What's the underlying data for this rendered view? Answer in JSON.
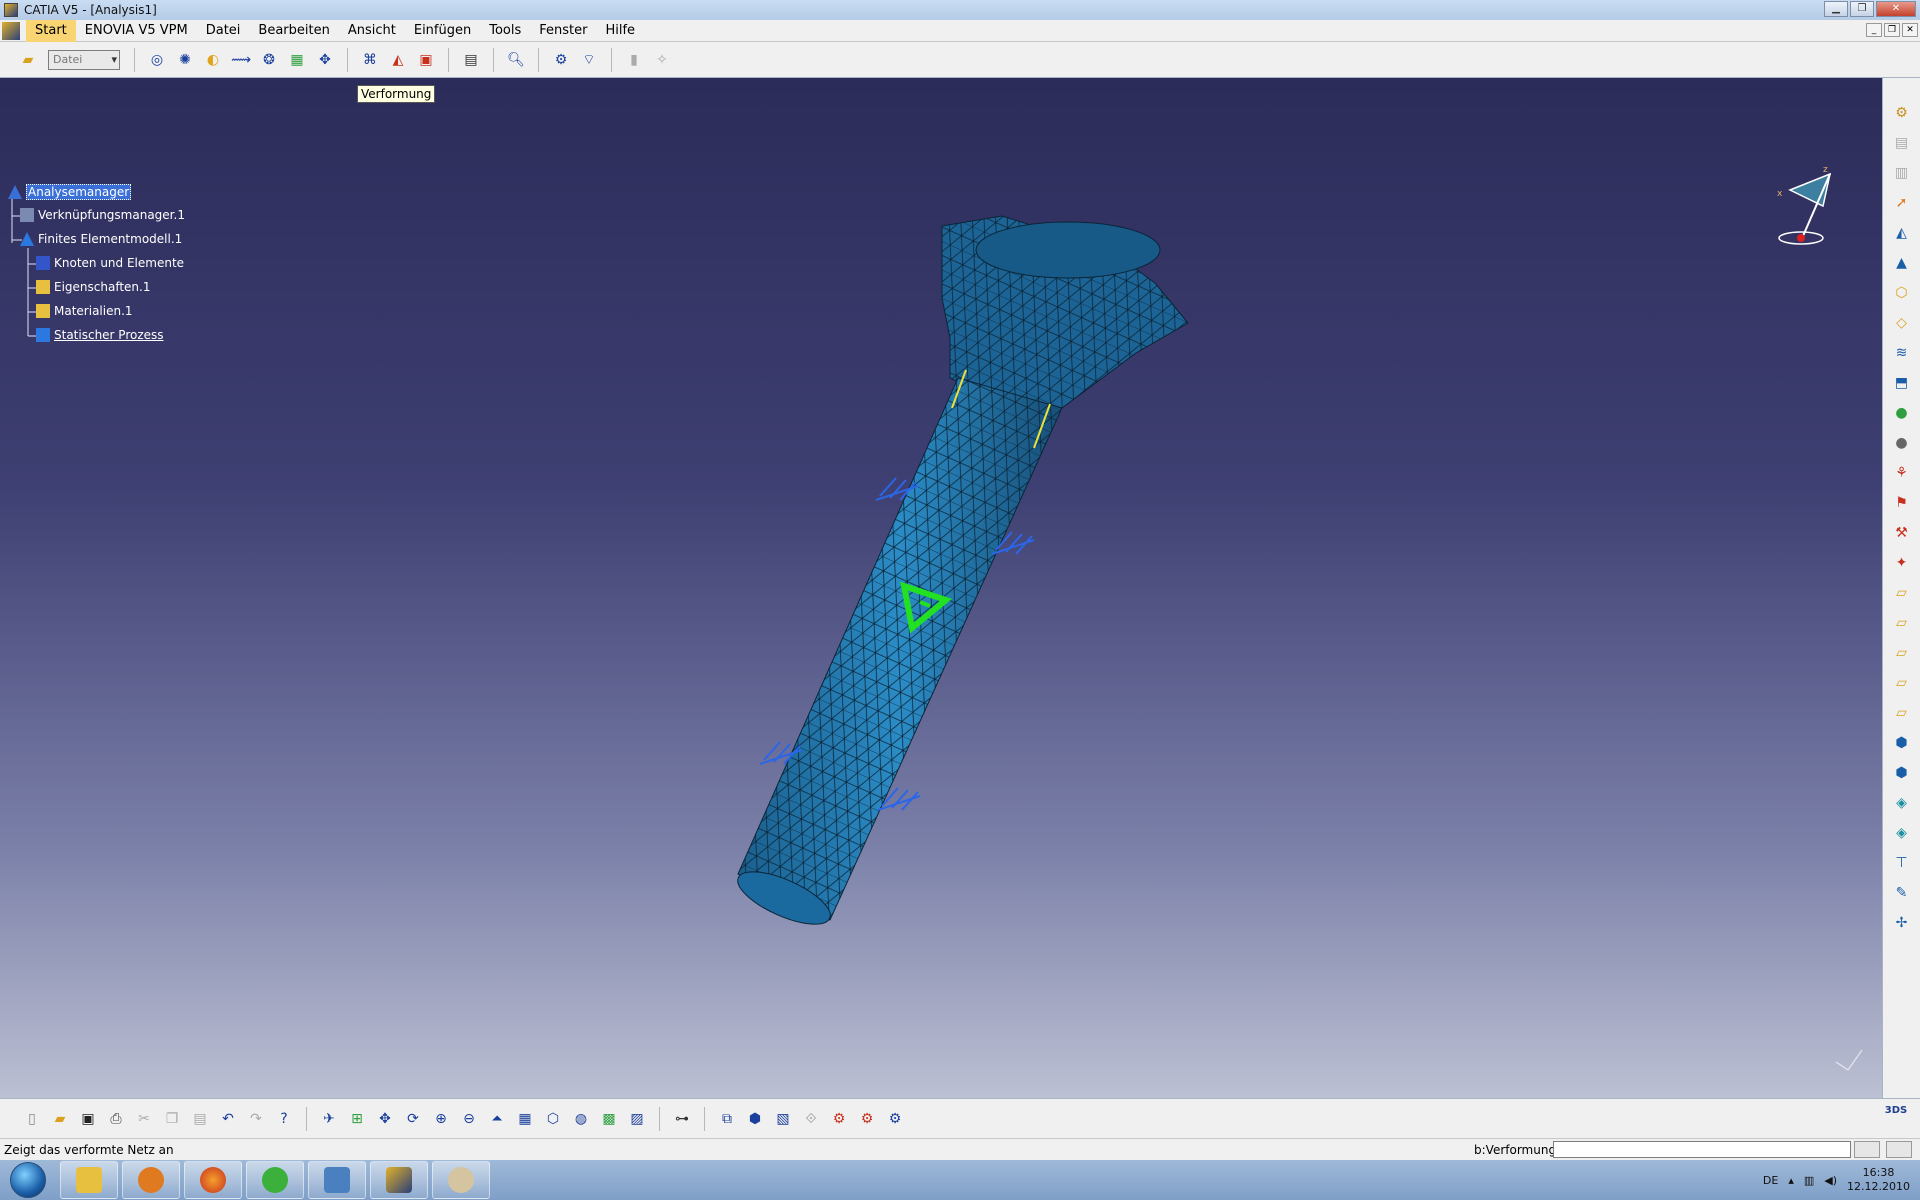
{
  "window": {
    "title": "CATIA V5 - [Analysis1]"
  },
  "menu": {
    "items": [
      "Start",
      "ENOVIA V5 VPM",
      "Datei",
      "Bearbeiten",
      "Ansicht",
      "Einfügen",
      "Tools",
      "Fenster",
      "Hilfe"
    ]
  },
  "toolbar": {
    "combo_value": "Datei"
  },
  "tooltip": {
    "text": "Verformung"
  },
  "tree": {
    "root": "Analysemanager",
    "items": [
      "Verknüpfungsmanager.1",
      "Finites Elementmodell.1",
      "Knoten und Elemente",
      "Eigenschaften.1",
      "Materialien.1",
      "Statischer Prozess"
    ]
  },
  "status": {
    "message": "Zeigt das verformte Netz an",
    "command_label": "b:Verformung",
    "command_value": ""
  },
  "taskbar": {
    "language": "DE",
    "time": "16:38",
    "date": "12.12.2010"
  },
  "colors": {
    "viewport_top": "#2c2c5a",
    "viewport_bottom": "#bcc0d3",
    "mesh": "#1f7fb8",
    "tree_selection": "#3a6fd8"
  }
}
